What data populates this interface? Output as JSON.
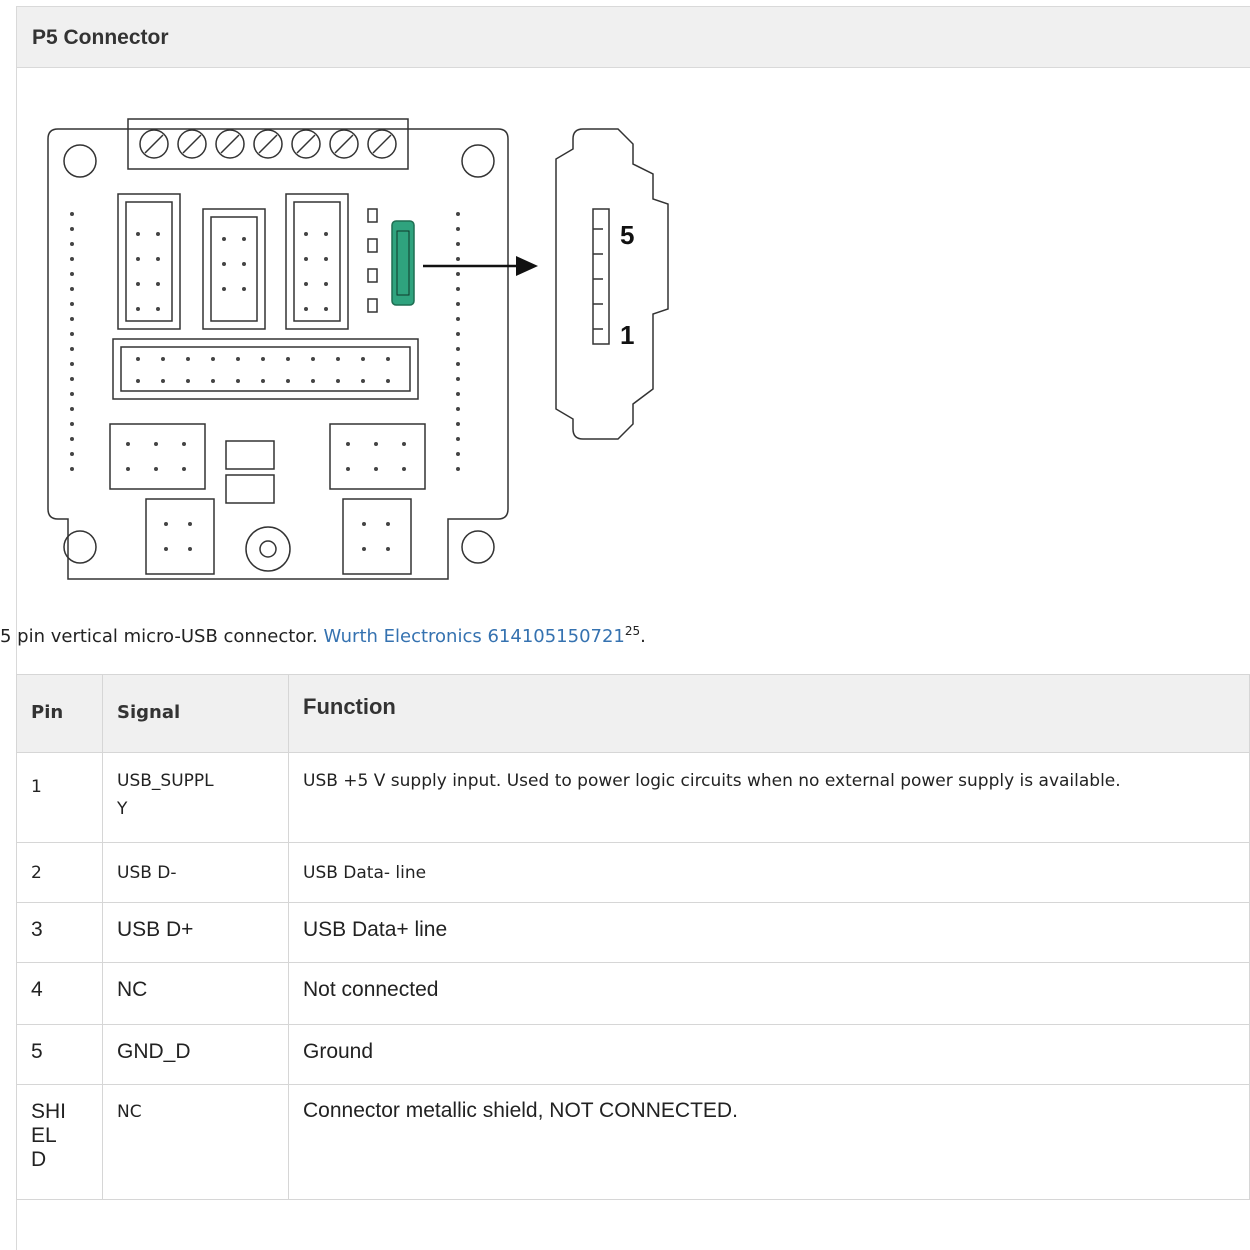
{
  "panel": {
    "title": "P5 Connector"
  },
  "figure": {
    "pin_label_top": "5",
    "pin_label_bottom": "1"
  },
  "caption": {
    "text": "5 pin vertical micro-USB connector. ",
    "link": "Wurth Electronics 614105150721",
    "footnote": "25",
    "end": "."
  },
  "table": {
    "headers": {
      "pin": "Pin",
      "signal": "Signal",
      "function": "Function"
    },
    "rows": [
      {
        "pin": "1",
        "signal": "USB_SUPPL\nY",
        "function": "USB +5 V supply input. Used to power logic circuits when no external power supply is available."
      },
      {
        "pin": "2",
        "signal": "USB D-",
        "function": "USB Data- line"
      },
      {
        "pin": "3",
        "signal": "USB D+",
        "function": "USB Data+ line"
      },
      {
        "pin": "4",
        "signal": "NC",
        "function": "Not connected"
      },
      {
        "pin": "5",
        "signal": "GND_D",
        "function": "Ground"
      },
      {
        "pin": "SHI\nEL\nD",
        "signal": "NC",
        "function": "Connector metallic shield, NOT CONNECTED."
      }
    ]
  }
}
